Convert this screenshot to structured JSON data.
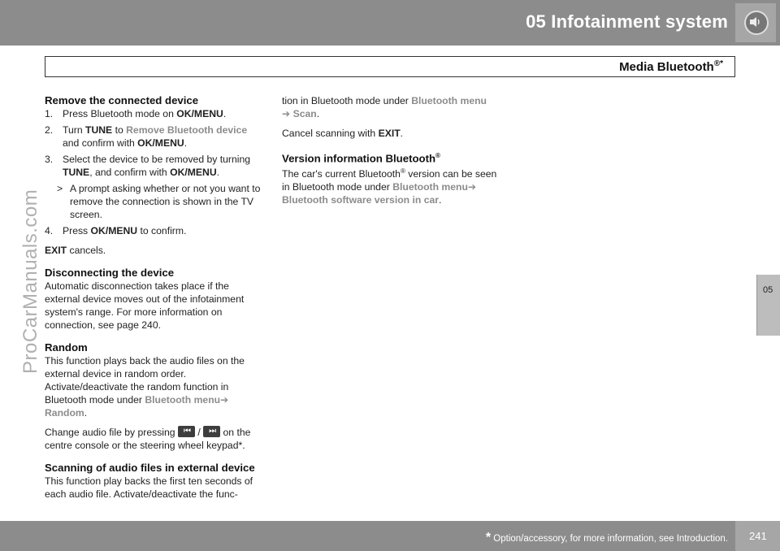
{
  "header": {
    "chapter_title": "05 Infotainment system",
    "section_title": "Media Bluetooth",
    "section_title_marks": "®*"
  },
  "side_tab": "05",
  "watermark": "ProCarManuals.com",
  "col1": {
    "remove": {
      "heading": "Remove the connected device",
      "step1_num": "1.",
      "step1_a": "Press Bluetooth mode on ",
      "step1_b": "OK/MENU",
      "step1_c": ".",
      "step2_num": "2.",
      "step2_a": "Turn ",
      "step2_b": "TUNE",
      "step2_c": " to ",
      "step2_d": "Remove Bluetooth device",
      "step2_e": " and confirm with ",
      "step2_f": "OK/MENU",
      "step2_g": ".",
      "step3_num": "3.",
      "step3_a": "Select the device to be removed by turning ",
      "step3_b": "TUNE",
      "step3_c": ", and confirm with ",
      "step3_d": "OK/MENU",
      "step3_e": ".",
      "sub_mark": ">",
      "sub_text": "A prompt asking whether or not you want to remove the connection is shown in the TV screen.",
      "step4_num": "4.",
      "step4_a": "Press ",
      "step4_b": "OK/MENU",
      "step4_c": " to confirm.",
      "exit_a": "EXIT",
      "exit_b": " cancels."
    },
    "disconnect": {
      "heading": "Disconnecting the device",
      "body": "Automatic disconnection takes place if the external device moves out of the infotainment system's range. For more information on connection, see page 240."
    },
    "random": {
      "heading": "Random",
      "body_a": "This function plays back the audio files on the external device in random order. Activate/deactivate the random function in Bluetooth mode under ",
      "body_b": "Bluetooth menu",
      "body_arrow": "➔",
      "body_c": " Random",
      "body_d": ".",
      "change_a": "Change audio file by pressing ",
      "change_prev_icon": "⏮",
      "change_slash": " / ",
      "change_next_icon": "⏭",
      "change_b": " on the centre console or the steering wheel keypad*."
    },
    "scan": {
      "heading": "Scanning of audio files in external device",
      "body": "This function play backs the first ten seconds of each audio file. Activate/deactivate the func-"
    }
  },
  "col2": {
    "cont_a": "tion in Bluetooth mode under ",
    "cont_b": "Bluetooth menu",
    "cont_arrow": "➔",
    "cont_c": " Scan",
    "cont_d": ".",
    "cancel_a": "Cancel scanning with ",
    "cancel_b": "EXIT",
    "cancel_c": ".",
    "version": {
      "heading": "Version information Bluetooth",
      "heading_sup": "®",
      "body_a": "The car's current Bluetooth",
      "body_sup": "®",
      "body_b": " version can be seen in Bluetooth mode under ",
      "body_c": "Bluetooth menu",
      "body_arrow": "➔",
      "body_d": " Bluetooth software version in car",
      "body_e": "."
    }
  },
  "footer": {
    "star": "*",
    "note": " Option/accessory, for more information, see Introduction.",
    "page": "241"
  },
  "colors": {
    "bar": "#8c8c8c",
    "menu_path": "#8c8c8c",
    "text": "#222222"
  }
}
